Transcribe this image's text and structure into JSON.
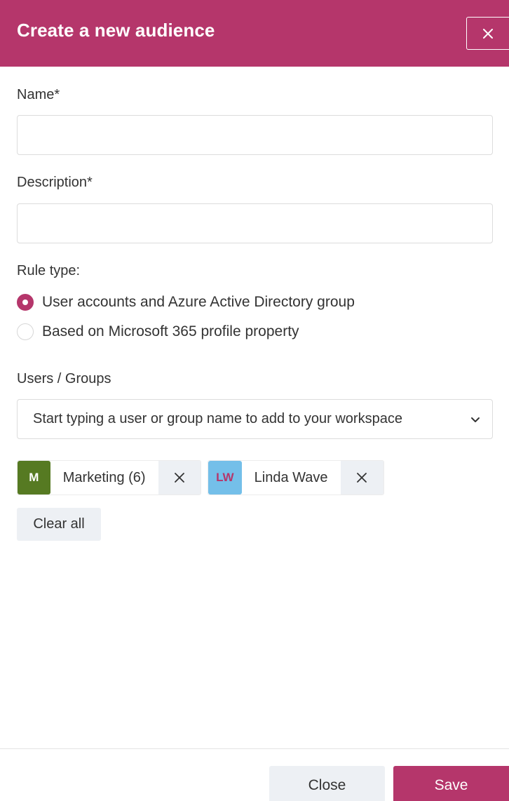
{
  "header": {
    "title": "Create a new audience"
  },
  "form": {
    "name_label": "Name*",
    "name_value": "",
    "description_label": "Description*",
    "description_value": "",
    "rule_type_label": "Rule type:",
    "rule_options": [
      {
        "label": "User accounts and Azure Active Directory group",
        "selected": true
      },
      {
        "label": "Based on Microsoft 365 profile property",
        "selected": false
      }
    ],
    "users_groups_label": "Users / Groups",
    "users_groups_select": "Start typing a user or group name to add to your workspace"
  },
  "selected_items": [
    {
      "initials": "M",
      "label": "Marketing (6)",
      "avatar_bg": "#567a22",
      "avatar_fg": "#ffffff"
    },
    {
      "initials": "LW",
      "label": "Linda Wave",
      "avatar_bg": "#74bfe9",
      "avatar_fg": "#b5366b"
    }
  ],
  "clear_all_label": "Clear all",
  "footer": {
    "close_label": "Close",
    "save_label": "Save"
  },
  "colors": {
    "brand": "#b5366b",
    "secondary_button_bg": "#edf0f4"
  }
}
